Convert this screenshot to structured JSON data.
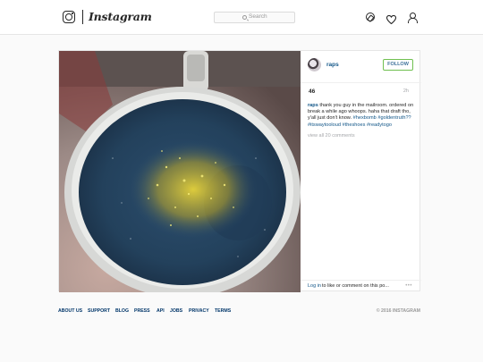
{
  "header": {
    "logo_text": "Instagram",
    "search_placeholder": "Search"
  },
  "post": {
    "username": "raps",
    "follow_label": "FOLLOW",
    "likes": "46",
    "time": "2h",
    "caption_user": "raps",
    "caption_text": "thank you guy in the mailroom. ordered on break a while ago whoops. haha that draft tho, y'all just don't know.",
    "hashtags": [
      "#hexbomb",
      "#goldentruth??",
      "#itswaytooloud",
      "#theshoes",
      "#readytogo"
    ],
    "view_all_comments": "view all 20 comments",
    "login_link": "Log in",
    "login_rest": "to like or comment on this po...",
    "more_label": "•••"
  },
  "footer": {
    "links": [
      "ABOUT US",
      "SUPPORT",
      "BLOG",
      "PRESS",
      "API",
      "JOBS",
      "PRIVACY",
      "TERMS"
    ],
    "copyright": "© 2016 INSTAGRAM"
  }
}
